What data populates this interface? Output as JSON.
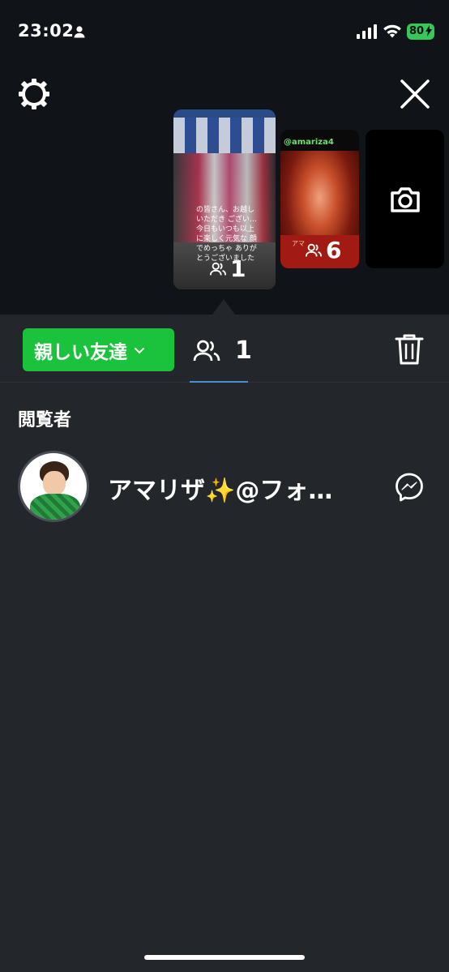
{
  "status_bar": {
    "time": "23:02",
    "battery": "80"
  },
  "top_area": {
    "story_thumbnails": [
      {
        "caption": "の皆さん、お越しいただき ござい… 今日もいつも以上に楽しく元気な 顔でめっちゃ ありがとうございました",
        "viewer_count": "1"
      },
      {
        "handle": "@amariza4",
        "band_text": "アマ",
        "viewer_count": "6"
      },
      {
        "icon": "camera-icon"
      }
    ]
  },
  "tabbar": {
    "close_friends_label": "親しい友達",
    "viewers_count": "1",
    "active_tab_color": "#4a8ddb",
    "accent_green": "#1bc23b"
  },
  "viewers_section": {
    "title": "閲覧者",
    "viewers": [
      {
        "name": "アマリザ✨@フォ…"
      }
    ]
  }
}
